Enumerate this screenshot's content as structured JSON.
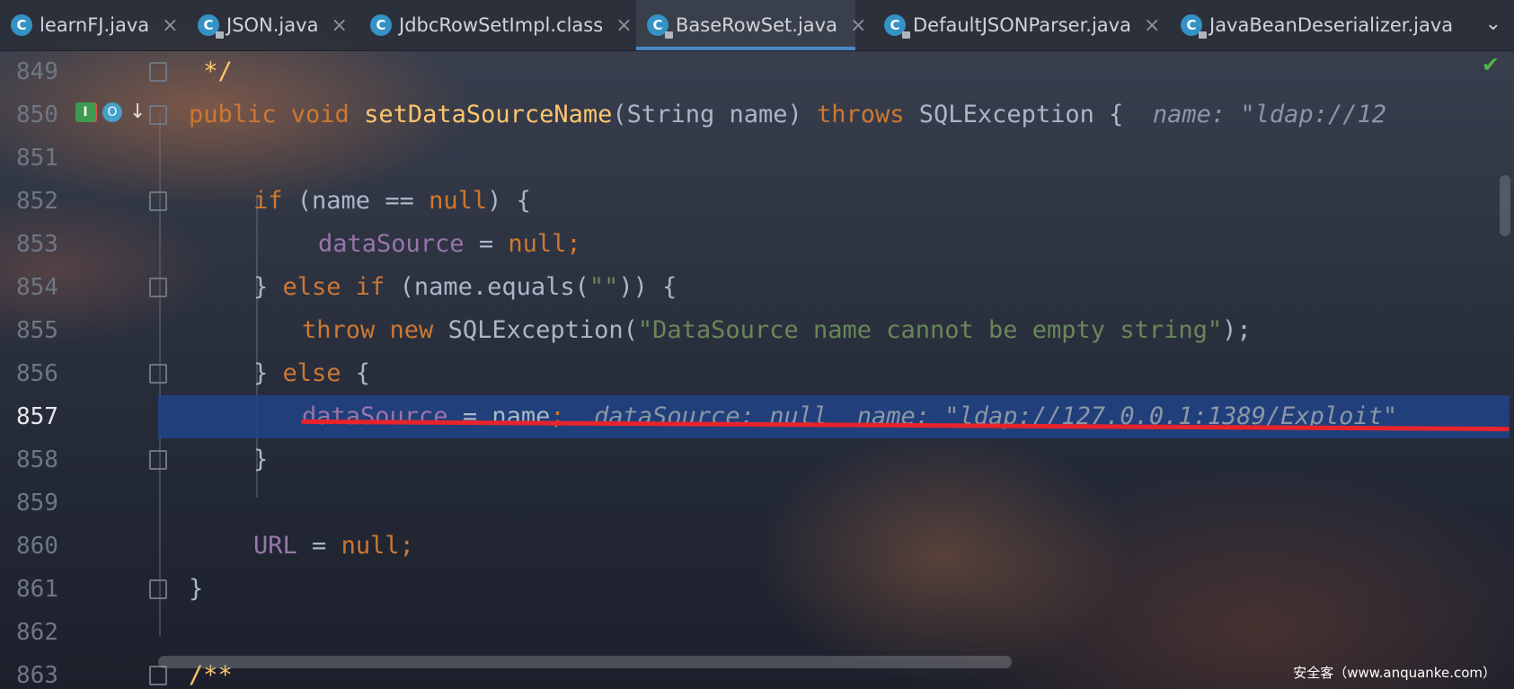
{
  "tabs": [
    {
      "label": "learnFJ.java",
      "icon": "java-class-icon"
    },
    {
      "label": "JSON.java",
      "icon": "java-class-readonly-icon"
    },
    {
      "label": "JdbcRowSetImpl.class",
      "icon": "java-class-icon"
    },
    {
      "label": "BaseRowSet.java",
      "icon": "java-class-readonly-icon",
      "active": true
    },
    {
      "label": "DefaultJSONParser.java",
      "icon": "java-class-readonly-icon"
    },
    {
      "label": "JavaBeanDeserializer.java",
      "icon": "java-class-readonly-icon"
    }
  ],
  "tab_icon_letter": "C",
  "tab_close_glyph": "×",
  "tab_more_glyph": "⌄",
  "status": {
    "inspection_ok": "✔"
  },
  "lines": [
    {
      "num": "849",
      "code": {
        "comment": " */"
      }
    },
    {
      "num": "850",
      "code": {
        "kw1": "public void ",
        "fn": "setDataSourceName",
        "p1": "(String name) ",
        "kw2": "throws ",
        "p2": "SQLException {",
        "hint": "  name: \"ldap://12"
      }
    },
    {
      "num": "851"
    },
    {
      "num": "852",
      "code": {
        "kw1": "if ",
        "p1": "(name == ",
        "kw2": "null",
        "p2": ") {"
      }
    },
    {
      "num": "853",
      "code": {
        "fld": "dataSource",
        "p1": " = ",
        "kw1": "null",
        "p2": ";"
      }
    },
    {
      "num": "854",
      "code": {
        "p1": "} ",
        "kw1": "else if ",
        "p2": "(name.equals(",
        "str": "\"\"",
        "p3": ")) {"
      }
    },
    {
      "num": "855",
      "code": {
        "kw1": "throw new ",
        "p1": "SQLException(",
        "str": "\"DataSource name cannot be empty string\"",
        "p2": ");"
      }
    },
    {
      "num": "856",
      "code": {
        "p1": "} ",
        "kw1": "else ",
        "p2": "{"
      }
    },
    {
      "num": "857",
      "code": {
        "fld": "dataSource",
        "p1": " = name",
        "p2": ";",
        "hint": "  dataSource: null  name: \"ldap://127.0.0.1:1389/Exploit\""
      }
    },
    {
      "num": "858",
      "code": {
        "p1": "}"
      }
    },
    {
      "num": "859"
    },
    {
      "num": "860",
      "code": {
        "fld": "URL",
        "p1": " = ",
        "kw1": "null",
        "p2": ";"
      }
    },
    {
      "num": "861",
      "code": {
        "p1": "}"
      }
    },
    {
      "num": "862"
    },
    {
      "num": "863",
      "code": {
        "comment": "/**"
      }
    }
  ],
  "gutter": {
    "impl_glyph": "I",
    "override_glyph": "O",
    "arrow_glyph": "↓"
  },
  "watermark": "安全客（www.anquanke.com）",
  "colors": {
    "keyword": "#cc7832",
    "function": "#ffc66d",
    "field": "#9876aa",
    "string": "#6a8759",
    "highlight": "#214283",
    "underline": "#e8232b",
    "tab_active": "#4a88c7"
  }
}
